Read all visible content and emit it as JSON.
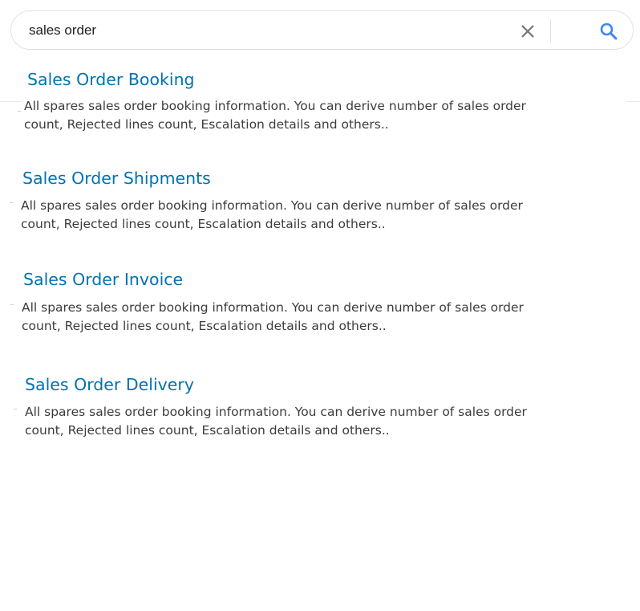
{
  "search": {
    "query": "sales order",
    "clear_icon": "close-icon",
    "search_icon": "search-icon"
  },
  "colors": {
    "title": "#0072b1",
    "description": "#3c3c3c",
    "search_icon": "#4285f4",
    "clear_icon": "#70757a"
  },
  "results": [
    {
      "title": "Sales Order Booking",
      "description": "All spares sales order booking information. You can derive number of sales order count, Rejected lines count, Escalation details and others.."
    },
    {
      "title": "Sales Order Shipments",
      "description": "All spares sales order booking information. You can derive number of sales order count, Rejected lines count, Escalation details and others.."
    },
    {
      "title": "Sales Order Invoice",
      "description": "All spares sales order booking information. You can derive number of sales order count, Rejected lines count, Escalation details and others.."
    },
    {
      "title": "Sales Order Delivery",
      "description": "All spares sales order booking information. You can derive number of sales order count, Rejected lines count, Escalation details and others.."
    }
  ]
}
